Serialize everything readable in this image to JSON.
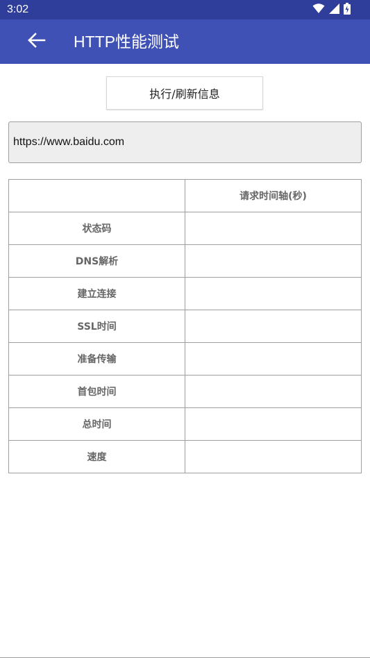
{
  "status_bar": {
    "time": "3:02"
  },
  "app_bar": {
    "title": "HTTP性能测试"
  },
  "actions": {
    "refresh_label": "执行/刷新信息"
  },
  "url_input": {
    "value": "https://www.baidu.com"
  },
  "table": {
    "header": [
      "",
      "请求时间轴(秒)"
    ],
    "rows": [
      {
        "label": "状态码",
        "value": ""
      },
      {
        "label": "DNS解析",
        "value": ""
      },
      {
        "label": "建立连接",
        "value": ""
      },
      {
        "label": "SSL时间",
        "value": ""
      },
      {
        "label": "准备传输",
        "value": ""
      },
      {
        "label": "首包时间",
        "value": ""
      },
      {
        "label": "总时间",
        "value": ""
      },
      {
        "label": "速度",
        "value": ""
      }
    ]
  },
  "colors": {
    "status_bar": "#2f3e9a",
    "app_bar": "#3f51b5",
    "input_bg": "#eeeeee",
    "grid": "#9e9e9e"
  },
  "icons": [
    "wifi-icon",
    "cell-signal-icon",
    "battery-icon",
    "back-arrow-icon"
  ]
}
